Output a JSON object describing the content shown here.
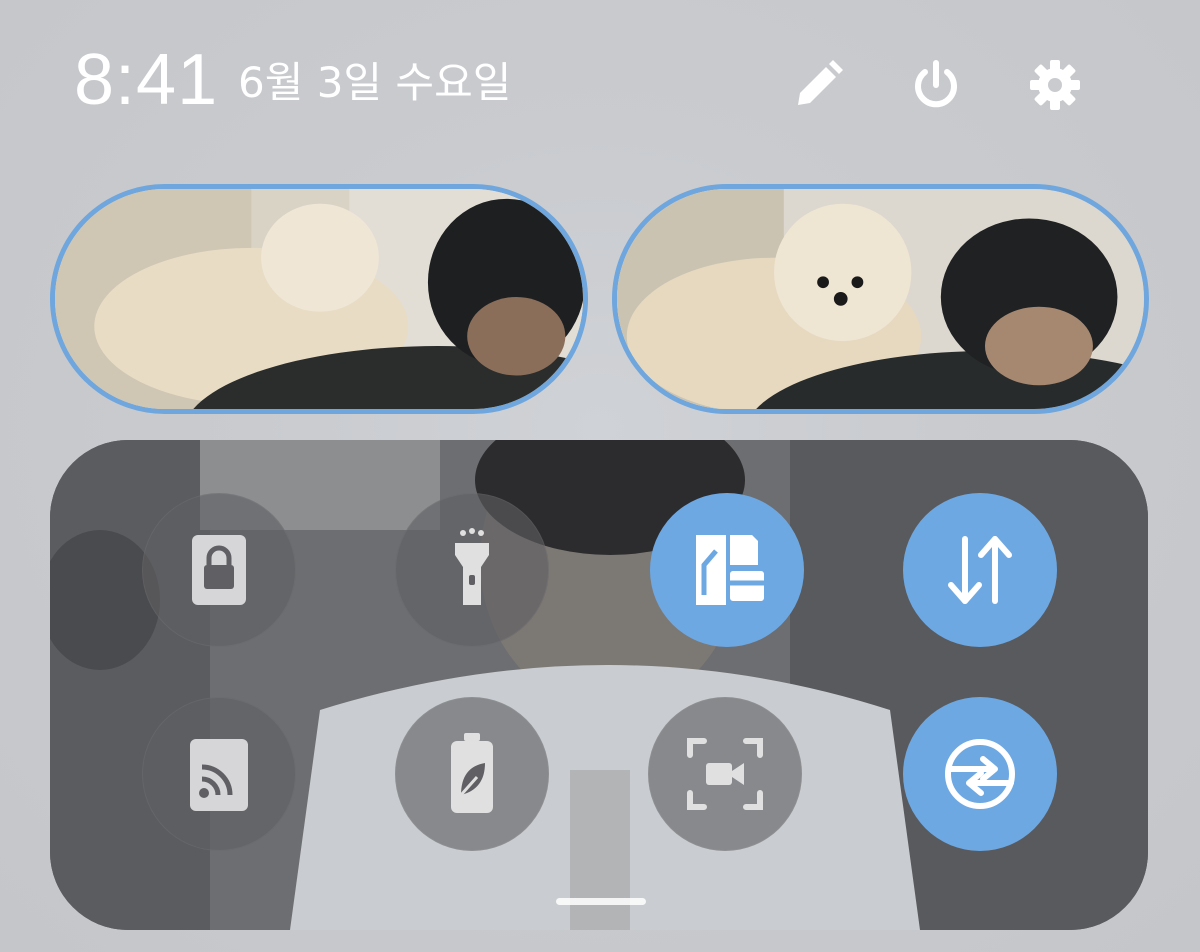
{
  "status": {
    "time": "8:41",
    "date": "6월 3일 수요일"
  },
  "header_icons": [
    "pencil-icon",
    "power-icon",
    "gear-icon"
  ],
  "media": {
    "left_pill": "photo",
    "right_pill": "photo"
  },
  "quick_tiles": [
    {
      "icon": "lock-icon",
      "state": "off"
    },
    {
      "icon": "flashlight-icon",
      "state": "off"
    },
    {
      "icon": "dual-sim-icon",
      "state": "on"
    },
    {
      "icon": "data-transfer-icon",
      "state": "on"
    },
    {
      "icon": "cast-icon",
      "state": "off"
    },
    {
      "icon": "power-saving-icon",
      "state": "off"
    },
    {
      "icon": "screen-record-icon",
      "state": "off"
    },
    {
      "icon": "auto-rotate-icon",
      "state": "on"
    }
  ],
  "colors": {
    "accent": "#6ea8e2",
    "pill_border": "#6ea6dd",
    "tile_off": "#5f5f62",
    "text": "#ffffff"
  }
}
